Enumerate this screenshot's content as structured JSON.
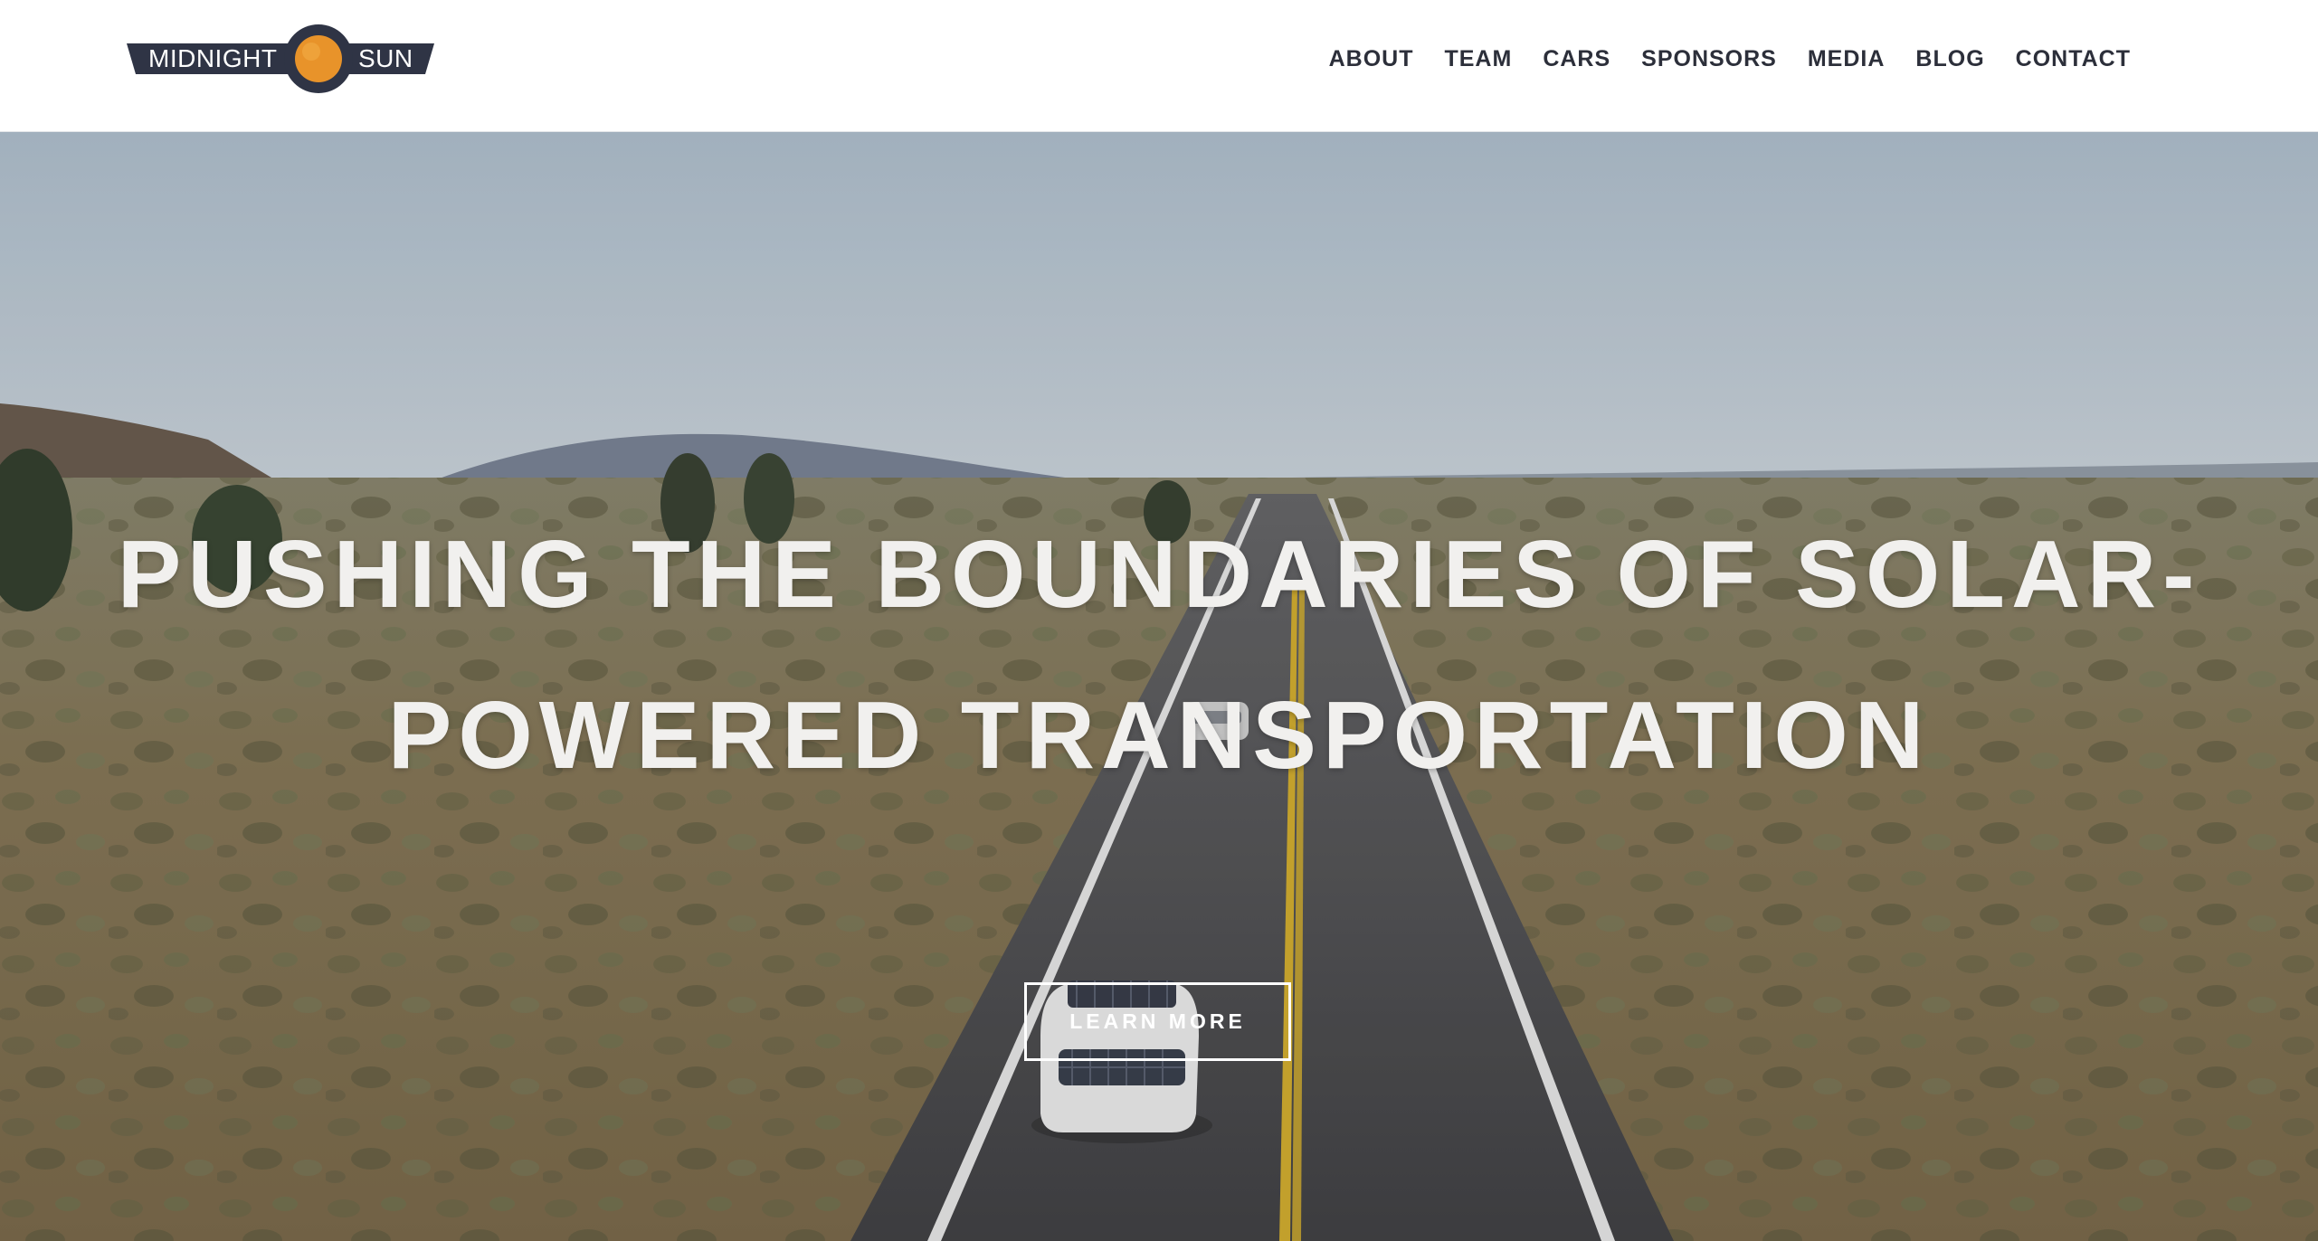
{
  "header": {
    "logo": {
      "left_text": "MIDNIGHT",
      "right_text": "SUN"
    },
    "nav": [
      {
        "label": "ABOUT"
      },
      {
        "label": "TEAM"
      },
      {
        "label": "CARS"
      },
      {
        "label": "SPONSORS"
      },
      {
        "label": "MEDIA"
      },
      {
        "label": "BLOG"
      },
      {
        "label": "CONTACT"
      }
    ]
  },
  "hero": {
    "headline_line1": "PUSHING THE BOUNDARIES OF SOLAR-",
    "headline_line2": "POWERED TRANSPORTATION",
    "cta_label": "LEARN MORE"
  },
  "colors": {
    "nav_text": "#2c2f3a",
    "logo_badge": "#2f3445",
    "logo_sun": "#e8932a",
    "sky": "#c2d0dc",
    "desert": "#8a7a5c",
    "road": "#4d4d50",
    "road_center_line": "#d8b331"
  },
  "icons": {
    "logo_sun": "sun-icon"
  }
}
